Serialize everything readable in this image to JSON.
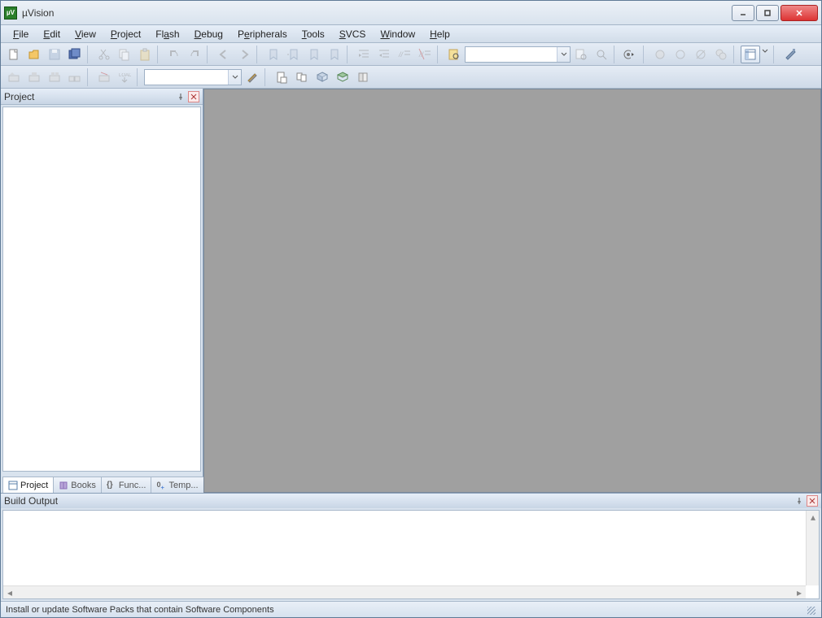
{
  "window": {
    "title": "µVision"
  },
  "menu": {
    "file": "File",
    "edit": "Edit",
    "view": "View",
    "project": "Project",
    "flash": "Flash",
    "debug": "Debug",
    "peripherals": "Peripherals",
    "tools": "Tools",
    "svcs": "SVCS",
    "window": "Window",
    "help": "Help"
  },
  "toolbar1": {
    "search_value": ""
  },
  "toolbar2": {
    "target_value": "",
    "load_label": "LOAD"
  },
  "project_panel": {
    "title": "Project",
    "tabs": {
      "project": "Project",
      "books": "Books",
      "functions": "Func...",
      "templates": "Temp..."
    }
  },
  "build_output": {
    "title": "Build Output"
  },
  "statusbar": {
    "text": "Install or update Software Packs that contain Software Components"
  }
}
